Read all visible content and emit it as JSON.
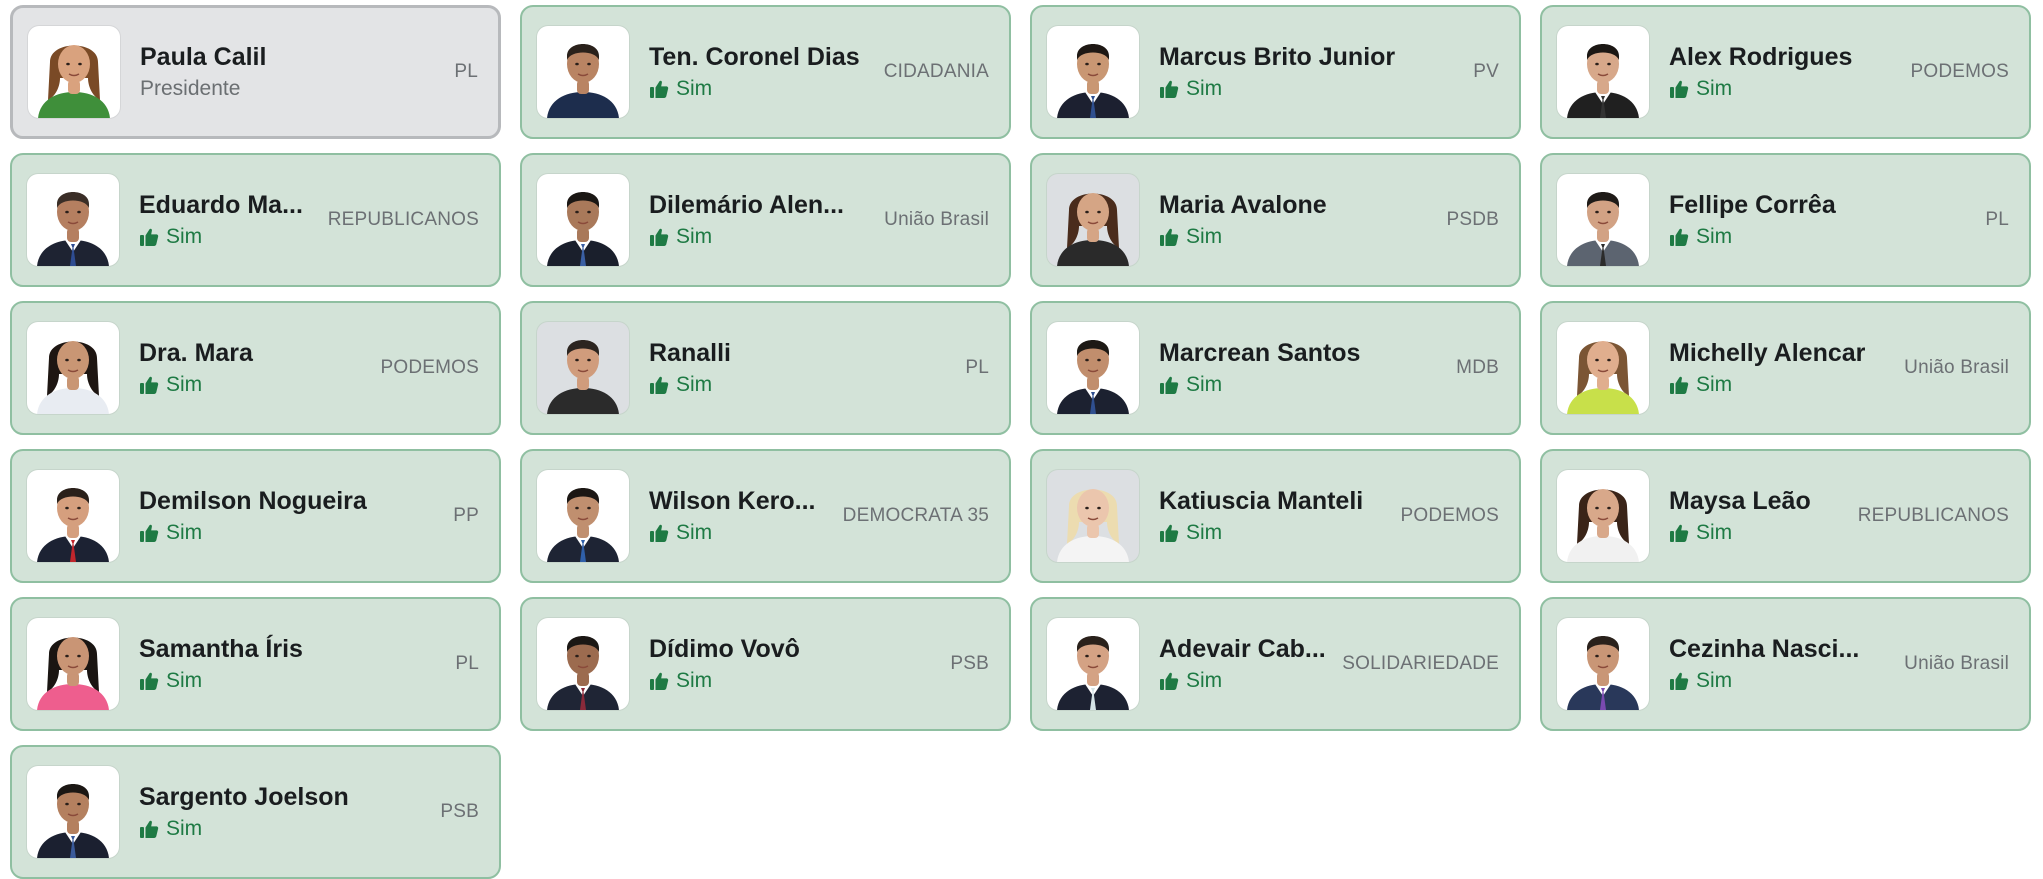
{
  "colors": {
    "card_bg": "#d3e3d8",
    "card_border": "#8fbfa1",
    "president_bg": "#e3e4e6",
    "president_border": "#b7b9bc",
    "vote_green": "#1e7a44",
    "party_gray": "#6c7074"
  },
  "vote_icon": "thumbs-up-icon",
  "members": [
    {
      "name": "Paula Calil",
      "role": "Presidente",
      "party": "PL",
      "president": true,
      "skin": "#d9a27e",
      "hair": "#7a4a26",
      "shirt": "#3f8f3a",
      "tie": "",
      "female": true
    },
    {
      "name": "Ten. Coronel Dias",
      "vote": "Sim",
      "party": "CIDADANIA",
      "skin": "#b98463",
      "hair": "#2a211b",
      "shirt": "#1d2d4d",
      "tie": "",
      "female": false
    },
    {
      "name": "Marcus Brito Junior",
      "vote": "Sim",
      "party": "PV",
      "skin": "#c99773",
      "hair": "#1e1814",
      "shirt": "#1c2030",
      "tie": "#2f4f8f",
      "female": false
    },
    {
      "name": "Alex Rodrigues",
      "vote": "Sim",
      "party": "PODEMOS",
      "skin": "#d7a88a",
      "hair": "#1b1714",
      "shirt": "#202020",
      "tie": "#333333",
      "female": false
    },
    {
      "name": "Eduardo Ma...",
      "vote": "Sim",
      "party": "REPUBLICANOS",
      "skin": "#b57f60",
      "hair": "#3a2e27",
      "shirt": "#1e2332",
      "tie": "#2e4c91",
      "female": false
    },
    {
      "name": "Dilemário Alen...",
      "vote": "Sim",
      "party": "União Brasil",
      "skin": "#a9795a",
      "hair": "#1b1714",
      "shirt": "#1a1f2c",
      "tie": "#3a5fa3",
      "female": false
    },
    {
      "name": "Maria Avalone",
      "vote": "Sim",
      "party": "PSDB",
      "skin": "#d5a585",
      "hair": "#4a2c1c",
      "shirt": "#2a2a2a",
      "tie": "",
      "female": true,
      "greybg": true
    },
    {
      "name": "Fellipe Corrêa",
      "vote": "Sim",
      "party": "PL",
      "skin": "#d2a284",
      "hair": "#1f1b18",
      "shirt": "#5c6470",
      "tie": "#2b2b2b",
      "female": false
    },
    {
      "name": "Dra. Mara",
      "vote": "Sim",
      "party": "PODEMOS",
      "skin": "#c99674",
      "hair": "#1e1612",
      "shirt": "#e8ecf2",
      "tie": "",
      "female": true
    },
    {
      "name": "Ranalli",
      "vote": "Sim",
      "party": "PL",
      "skin": "#d09c7c",
      "hair": "#2c2520",
      "shirt": "#2b2b2b",
      "tie": "",
      "female": false,
      "greybg": true
    },
    {
      "name": "Marcrean Santos",
      "vote": "Sim",
      "party": "MDB",
      "skin": "#c18e6d",
      "hair": "#1d1915",
      "shirt": "#1c2130",
      "tie": "#2f4f8f",
      "female": false
    },
    {
      "name": "Michelly Alencar",
      "vote": "Sim",
      "party": "União Brasil",
      "skin": "#e0ae8e",
      "hair": "#7b5534",
      "shirt": "#c8e04a",
      "tie": "",
      "female": true
    },
    {
      "name": "Demilson Nogueira",
      "vote": "Sim",
      "party": "PP",
      "skin": "#d59f7e",
      "hair": "#2a201a",
      "shirt": "#1c2233",
      "tie": "#c0262c",
      "female": false
    },
    {
      "name": "Wilson Kero...",
      "vote": "Sim",
      "party": "DEMOCRATA 35",
      "skin": "#c08f6f",
      "hair": "#1c1714",
      "shirt": "#1e2434",
      "tie": "#2f5fa8",
      "female": false
    },
    {
      "name": "Katiuscia Manteli",
      "vote": "Sim",
      "party": "PODEMOS",
      "skin": "#ebc6ad",
      "hair": "#ecdcb0",
      "shirt": "#f4f4f4",
      "tie": "",
      "female": true,
      "greybg": true
    },
    {
      "name": "Maysa Leão",
      "vote": "Sim",
      "party": "REPUBLICANOS",
      "skin": "#d8a88a",
      "hair": "#3a2418",
      "shirt": "#f1f1f1",
      "tie": "",
      "female": true
    },
    {
      "name": "Samantha Íris",
      "vote": "Sim",
      "party": "PL",
      "skin": "#c99575",
      "hair": "#1a1512",
      "shirt": "#ee5e8e",
      "tie": "",
      "female": true
    },
    {
      "name": "Dídimo Vovô",
      "vote": "Sim",
      "party": "PSB",
      "skin": "#9c6b4f",
      "hair": "#1b1714",
      "shirt": "#1f2535",
      "tie": "#8a2a3a",
      "female": false
    },
    {
      "name": "Adevair Cab...",
      "vote": "Sim",
      "party": "SOLIDARIEDADE",
      "skin": "#d4a284",
      "hair": "#2a211b",
      "shirt": "#1d2232",
      "tie": "#d4e3e6",
      "female": false
    },
    {
      "name": "Cezinha Nasci...",
      "vote": "Sim",
      "party": "União Brasil",
      "skin": "#c99676",
      "hair": "#2a211b",
      "shirt": "#29385a",
      "tie": "#7a4ab0",
      "female": false
    },
    {
      "name": "Sargento Joelson",
      "vote": "Sim",
      "party": "PSB",
      "skin": "#b4805f",
      "hair": "#1b1714",
      "shirt": "#1b2030",
      "tie": "#3a5a9a",
      "female": false
    }
  ]
}
